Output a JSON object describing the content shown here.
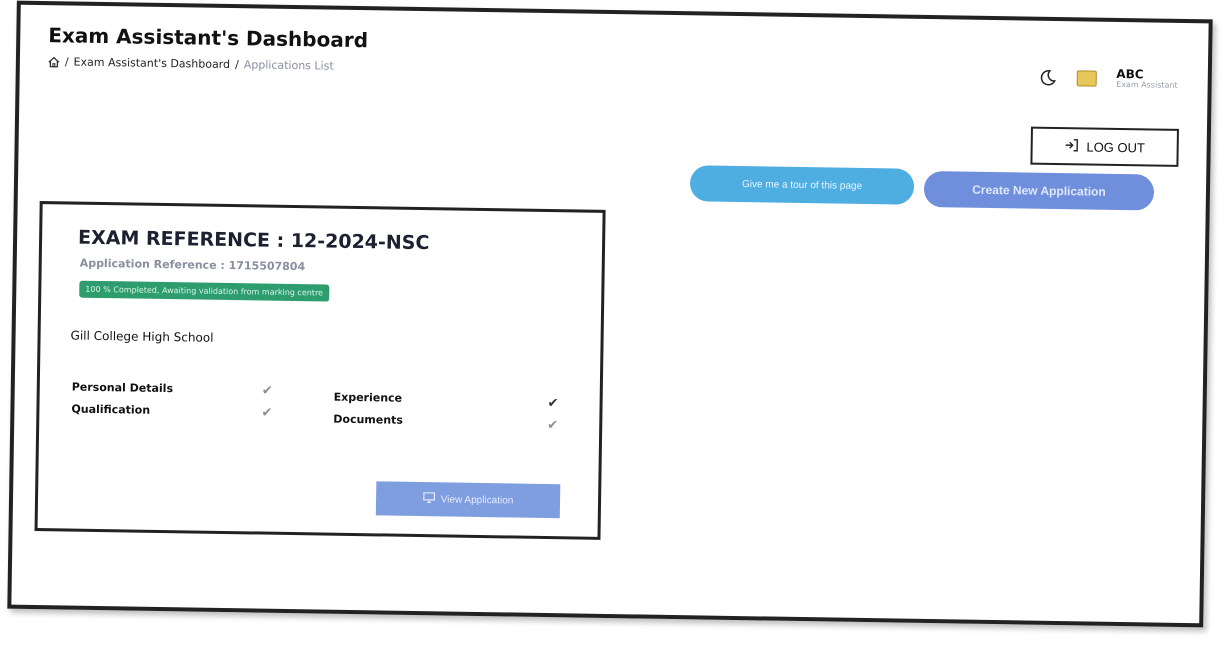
{
  "header": {
    "title": "Exam Assistant's Dashboard",
    "breadcrumb": {
      "separator_1": "/",
      "dashboard": "Exam Assistant's Dashboard",
      "separator_2": "/",
      "current": "Applications List"
    }
  },
  "user": {
    "name": "ABC",
    "role": "Exam Assistant"
  },
  "actions": {
    "logout_label": "LOG OUT",
    "tour_label": "Give me a tour of this page",
    "create_label": "Create New Application"
  },
  "application": {
    "exam_reference": "EXAM REFERENCE : 12-2024-NSC",
    "application_reference": "Application Reference : 1715507804",
    "status": "100 % Completed, Awaiting validation from marking centre",
    "school": "Gill College High School",
    "checklist": [
      {
        "label": "Personal Details",
        "mark": "✔"
      },
      {
        "label": "Qualification",
        "mark": "✔"
      },
      {
        "label": "Experience",
        "mark": "✔"
      },
      {
        "label": "Documents",
        "mark": "✔"
      }
    ],
    "view_label": "View Application"
  },
  "colors": {
    "tour_button": "#4eaee2",
    "create_button": "#6f8fdc",
    "status_badge": "#2e9d6e",
    "view_button": "#7f9ee0"
  },
  "icons": [
    "home-icon",
    "moon-icon",
    "coat-of-arms-icon",
    "logout-icon",
    "monitor-icon",
    "check-icon"
  ]
}
